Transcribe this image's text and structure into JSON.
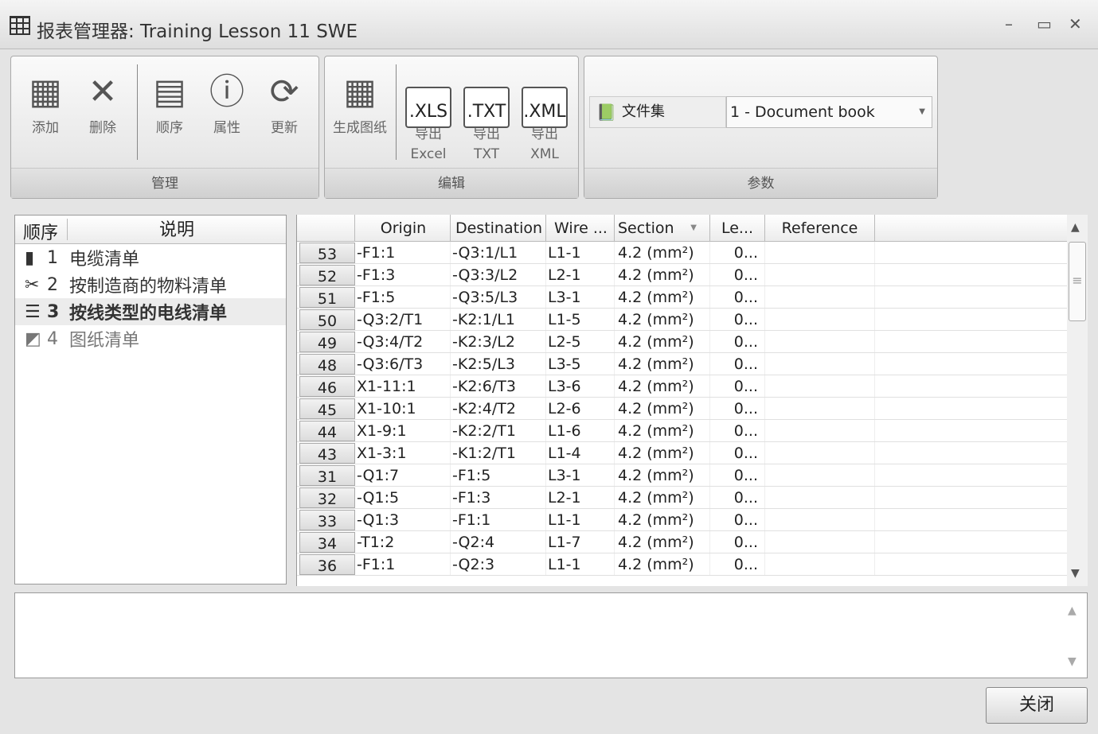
{
  "window": {
    "title": "报表管理器: Training Lesson 11 SWE",
    "minimize": "–",
    "maximize": "▭",
    "close": "✕"
  },
  "ribbon": {
    "manage": {
      "label": "管理",
      "buttons": [
        {
          "label": "添加"
        },
        {
          "label": "删除"
        },
        {
          "label": "顺序"
        },
        {
          "label": "属性"
        },
        {
          "label": "更新"
        }
      ]
    },
    "edit": {
      "label": "编辑",
      "generate": "生成图纸",
      "exports": [
        {
          "file": ".XLS",
          "label1": "导出",
          "label2": "Excel"
        },
        {
          "file": ".TXT",
          "label1": "导出",
          "label2": "TXT"
        },
        {
          "file": ".XML",
          "label1": "导出",
          "label2": "XML"
        }
      ]
    },
    "params": {
      "label": "参数",
      "field_label": "文件集",
      "value": "1 - Document book"
    }
  },
  "left": {
    "headers": [
      "顺序",
      "说明"
    ],
    "items": [
      {
        "n": "1",
        "label": "电缆清单",
        "icon": "cable-icon"
      },
      {
        "n": "2",
        "label": "按制造商的物料清单",
        "icon": "tools-icon"
      },
      {
        "n": "3",
        "label": "按线类型的电线清单",
        "icon": "list-icon",
        "selected": true
      },
      {
        "n": "4",
        "label": "图纸清单",
        "icon": "drawing-icon"
      }
    ]
  },
  "grid": {
    "headers": [
      "",
      "Origin",
      "Destination",
      "Wire ...",
      "Section",
      "Le...",
      "Reference"
    ],
    "rows": [
      [
        "53",
        "-F1:1",
        "-Q3:1/L1",
        "L1-1",
        "4.2 (mm²)",
        "0..."
      ],
      [
        "52",
        "-F1:3",
        "-Q3:3/L2",
        "L2-1",
        "4.2 (mm²)",
        "0..."
      ],
      [
        "51",
        "-F1:5",
        "-Q3:5/L3",
        "L3-1",
        "4.2 (mm²)",
        "0..."
      ],
      [
        "50",
        "-Q3:2/T1",
        "-K2:1/L1",
        "L1-5",
        "4.2 (mm²)",
        "0..."
      ],
      [
        "49",
        "-Q3:4/T2",
        "-K2:3/L2",
        "L2-5",
        "4.2 (mm²)",
        "0..."
      ],
      [
        "48",
        "-Q3:6/T3",
        "-K2:5/L3",
        "L3-5",
        "4.2 (mm²)",
        "0..."
      ],
      [
        "46",
        "X1-11:1",
        "-K2:6/T3",
        "L3-6",
        "4.2 (mm²)",
        "0..."
      ],
      [
        "45",
        "X1-10:1",
        "-K2:4/T2",
        "L2-6",
        "4.2 (mm²)",
        "0..."
      ],
      [
        "44",
        "X1-9:1",
        "-K2:2/T1",
        "L1-6",
        "4.2 (mm²)",
        "0..."
      ],
      [
        "43",
        "X1-3:1",
        "-K1:2/T1",
        "L1-4",
        "4.2 (mm²)",
        "0..."
      ],
      [
        "31",
        "-Q1:7",
        "-F1:5",
        "L3-1",
        "4.2 (mm²)",
        "0..."
      ],
      [
        "32",
        "-Q1:5",
        "-F1:3",
        "L2-1",
        "4.2 (mm²)",
        "0..."
      ],
      [
        "33",
        "-Q1:3",
        "-F1:1",
        "L1-1",
        "4.2 (mm²)",
        "0..."
      ],
      [
        "34",
        "-T1:2",
        "-Q2:4",
        "L1-7",
        "4.2 (mm²)",
        "0..."
      ],
      [
        "36",
        "-F1:1",
        "-Q2:3",
        "L1-1",
        "4.2 (mm²)",
        "0..."
      ]
    ]
  },
  "footer": {
    "close_label": "关闭"
  }
}
